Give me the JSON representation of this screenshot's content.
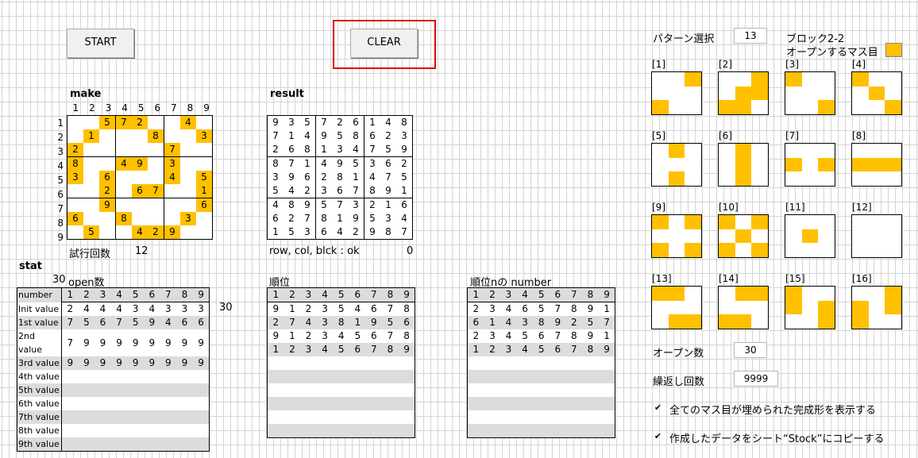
{
  "buttons": {
    "start": "START",
    "clear": "CLEAR"
  },
  "make": {
    "title": "make",
    "col_headers": [
      "1",
      "2",
      "3",
      "4",
      "5",
      "6",
      "7",
      "8",
      "9"
    ],
    "row_headers": [
      "1",
      "2",
      "3",
      "4",
      "5",
      "6",
      "7",
      "8",
      "9"
    ],
    "grid": [
      [
        "",
        "",
        "5",
        "7",
        "2",
        "",
        "",
        "4",
        ""
      ],
      [
        "",
        "1",
        "",
        "",
        "",
        "8",
        "",
        "",
        "3"
      ],
      [
        "2",
        "",
        "",
        "",
        "",
        "",
        "7",
        "",
        ""
      ],
      [
        "8",
        "",
        "",
        "4",
        "9",
        "",
        "3",
        "",
        ""
      ],
      [
        "3",
        "",
        "6",
        "",
        "",
        "",
        "4",
        "",
        "5"
      ],
      [
        "",
        "",
        "2",
        "",
        "6",
        "7",
        "",
        "",
        "1"
      ],
      [
        "",
        "",
        "9",
        "",
        "",
        "",
        "",
        "",
        "6"
      ],
      [
        "6",
        "",
        "",
        "8",
        "",
        "",
        "",
        "3",
        ""
      ],
      [
        "",
        "5",
        "",
        "",
        "4",
        "2",
        "9",
        "",
        ""
      ]
    ],
    "trial_label": "試行回数",
    "trial_value": "12"
  },
  "result": {
    "title": "result",
    "grid": [
      [
        "9",
        "3",
        "5",
        "7",
        "2",
        "6",
        "1",
        "4",
        "8"
      ],
      [
        "7",
        "1",
        "4",
        "9",
        "5",
        "8",
        "6",
        "2",
        "3"
      ],
      [
        "2",
        "6",
        "8",
        "1",
        "3",
        "4",
        "7",
        "5",
        "9"
      ],
      [
        "8",
        "7",
        "1",
        "4",
        "9",
        "5",
        "3",
        "6",
        "2"
      ],
      [
        "3",
        "9",
        "6",
        "2",
        "8",
        "1",
        "4",
        "7",
        "5"
      ],
      [
        "5",
        "4",
        "2",
        "3",
        "6",
        "7",
        "8",
        "9",
        "1"
      ],
      [
        "4",
        "8",
        "9",
        "5",
        "7",
        "3",
        "2",
        "1",
        "6"
      ],
      [
        "6",
        "2",
        "7",
        "8",
        "1",
        "9",
        "5",
        "3",
        "4"
      ],
      [
        "1",
        "5",
        "3",
        "6",
        "4",
        "2",
        "9",
        "8",
        "7"
      ]
    ],
    "status_label": "row, col, blck : ok",
    "status_value": "0"
  },
  "stat": {
    "title": "stat",
    "open_count": "30",
    "open_label": "open数",
    "order_label": "順位",
    "order_n_label": "順位nの number",
    "row_labels": [
      "number",
      "Init value",
      "1st value",
      "2nd value",
      "3rd value",
      "4th value",
      "5th value",
      "6th value",
      "7th value",
      "8th value",
      "9th value"
    ],
    "cols": [
      "1",
      "2",
      "3",
      "4",
      "5",
      "6",
      "7",
      "8",
      "9"
    ],
    "t1": [
      [
        "2",
        "4",
        "4",
        "4",
        "3",
        "4",
        "3",
        "3",
        "3"
      ],
      [
        "7",
        "5",
        "6",
        "7",
        "5",
        "9",
        "4",
        "6",
        "6"
      ],
      [
        "7",
        "9",
        "9",
        "9",
        "9",
        "9",
        "9",
        "9",
        "9"
      ],
      [
        "9",
        "9",
        "9",
        "9",
        "9",
        "9",
        "9",
        "9",
        "9"
      ]
    ],
    "t1_side": "30",
    "t2": [
      [
        "9",
        "1",
        "2",
        "3",
        "5",
        "4",
        "6",
        "7",
        "8"
      ],
      [
        "2",
        "7",
        "4",
        "3",
        "8",
        "1",
        "9",
        "5",
        "6"
      ],
      [
        "9",
        "1",
        "2",
        "3",
        "4",
        "5",
        "6",
        "7",
        "8"
      ],
      [
        "1",
        "2",
        "3",
        "4",
        "5",
        "6",
        "7",
        "8",
        "9"
      ]
    ],
    "t3": [
      [
        "2",
        "3",
        "4",
        "6",
        "5",
        "7",
        "8",
        "9",
        "1"
      ],
      [
        "6",
        "1",
        "4",
        "3",
        "8",
        "9",
        "2",
        "5",
        "7"
      ],
      [
        "2",
        "3",
        "4",
        "5",
        "6",
        "7",
        "8",
        "9",
        "1"
      ],
      [
        "1",
        "2",
        "3",
        "4",
        "5",
        "6",
        "7",
        "8",
        "9"
      ]
    ]
  },
  "right": {
    "pattern_label": "パターン選択",
    "pattern_value": "13",
    "block_label": "ブロック2-2",
    "open_cell_label": "オープンするマス目",
    "patterns": [
      {
        "label": "[1]",
        "cells": [
          2,
          6
        ]
      },
      {
        "label": "[2]",
        "cells": [
          2,
          4,
          5,
          6,
          7
        ]
      },
      {
        "label": "[3]",
        "cells": [
          0,
          8
        ]
      },
      {
        "label": "[4]",
        "cells": [
          0,
          4,
          8
        ]
      },
      {
        "label": "[5]",
        "cells": [
          1,
          7
        ]
      },
      {
        "label": "[6]",
        "cells": [
          1,
          4,
          7
        ]
      },
      {
        "label": "[7]",
        "cells": [
          3,
          5
        ]
      },
      {
        "label": "[8]",
        "cells": [
          3,
          4,
          5
        ]
      },
      {
        "label": "[9]",
        "cells": [
          0,
          2,
          6,
          8
        ]
      },
      {
        "label": "[10]",
        "cells": [
          0,
          2,
          4,
          6,
          8
        ]
      },
      {
        "label": "[11]",
        "cells": [
          4
        ]
      },
      {
        "label": "[12]",
        "cells": []
      },
      {
        "label": "[13]",
        "cells": [
          0,
          1,
          7,
          8
        ]
      },
      {
        "label": "[14]",
        "cells": [
          1,
          2,
          6,
          7
        ]
      },
      {
        "label": "[15]",
        "cells": [
          0,
          3,
          5,
          8
        ]
      },
      {
        "label": "[16]",
        "cells": [
          2,
          3,
          5,
          6
        ]
      }
    ],
    "open_count_label": "オープン数",
    "open_count_value": "30",
    "repeat_label": "繰返し回数",
    "repeat_value": "9999",
    "check1": "全てのマス目が埋められた完成形を表示する",
    "check2": "作成したデータをシート“Stock”にコピーする",
    "check_mark": "✔"
  },
  "colors": {
    "open_cell": "#ffc000",
    "highlight_border": "#e00000"
  }
}
